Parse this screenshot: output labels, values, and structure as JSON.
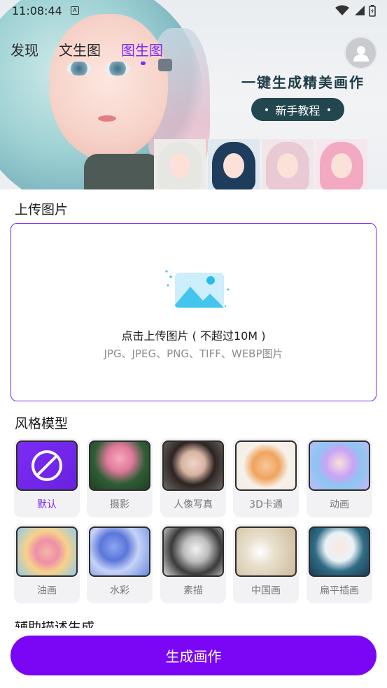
{
  "status_bar": {
    "time": "11:08:44",
    "notification_icon": "a-icon",
    "icons": [
      "wifi-icon",
      "signal-icon",
      "battery-icon"
    ]
  },
  "tabs": [
    {
      "label": "发现",
      "active": false
    },
    {
      "label": "文生图",
      "active": false
    },
    {
      "label": "图生图",
      "active": true
    }
  ],
  "banner": {
    "slogan": "一键生成精美画作",
    "tutorial_label": "新手教程"
  },
  "upload": {
    "title": "上传图片",
    "main_text": "点击上传图片 ( 不超过10M )",
    "formats_text": "JPG、JPEG、PNG、TIFF、WEBP图片"
  },
  "styles": {
    "title": "风格模型",
    "items": [
      {
        "label": "默认",
        "selected": true
      },
      {
        "label": "摄影",
        "selected": false
      },
      {
        "label": "人像写真",
        "selected": false
      },
      {
        "label": "3D卡通",
        "selected": false
      },
      {
        "label": "动画",
        "selected": false
      },
      {
        "label": "油画",
        "selected": false
      },
      {
        "label": "水彩",
        "selected": false
      },
      {
        "label": "素描",
        "selected": false
      },
      {
        "label": "中国画",
        "selected": false
      },
      {
        "label": "扁平插画",
        "selected": false
      }
    ]
  },
  "next_section_title": "辅助描述生成",
  "generate_label": "生成画作",
  "colors": {
    "accent": "#7b2cf5",
    "button": "#7a06f5",
    "tutorial_bg": "#23474f"
  }
}
